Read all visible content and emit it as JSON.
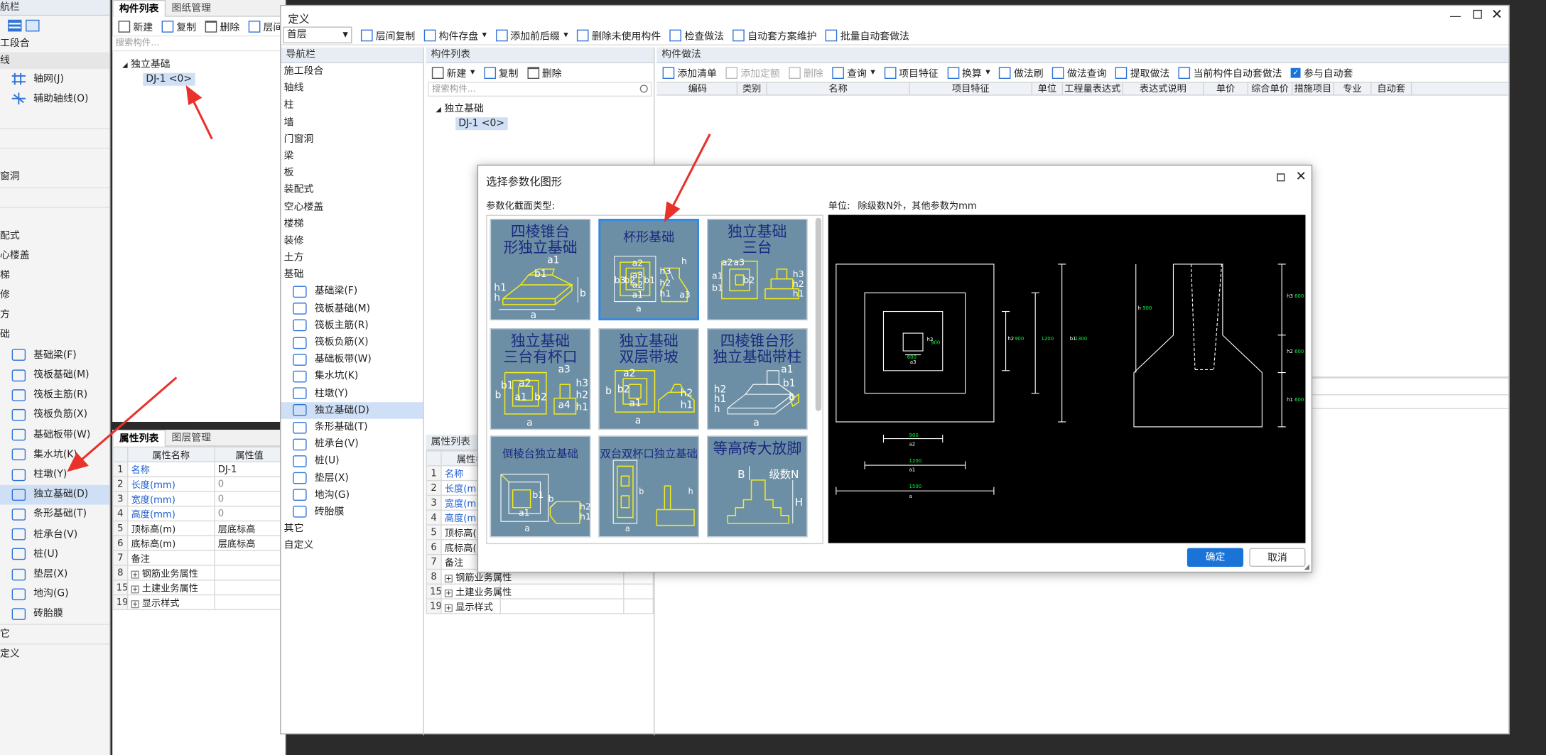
{
  "left_panel": {
    "title": "航栏",
    "items": [
      "工段合",
      "线"
    ],
    "axis_items": [
      "轴网(J)",
      "辅助轴线(O)"
    ],
    "mid_items": [
      "窗洞",
      "",
      "配式",
      "心楼盖",
      "梯",
      "修",
      "方",
      "础"
    ],
    "foundation_items": [
      "基础梁(F)",
      "筏板基础(M)",
      "筏板主筋(R)",
      "筏板负筋(X)",
      "基础板带(W)",
      "集水坑(K)",
      "柱墩(Y)",
      "独立基础(D)",
      "条形基础(T)",
      "桩承台(V)",
      "桩(U)",
      "垫层(X)",
      "地沟(G)",
      "砖胎膜"
    ],
    "tail_items": [
      "它",
      "定义"
    ]
  },
  "bg_component": {
    "tabs": [
      "构件列表",
      "图纸管理"
    ],
    "toolbar": [
      "新建",
      "复制",
      "删除",
      "层间"
    ],
    "search_placeholder": "搜索构件...",
    "tree_parent": "独立基础",
    "tree_child": "DJ-1 <0>"
  },
  "bg_props": {
    "tabs": [
      "属性列表",
      "图层管理"
    ],
    "header": [
      "属性名称",
      "属性值"
    ],
    "rows": [
      {
        "n": "1",
        "name": "名称",
        "val": "DJ-1",
        "blue": true
      },
      {
        "n": "2",
        "name": "长度(mm)",
        "val": "0",
        "blue": true
      },
      {
        "n": "3",
        "name": "宽度(mm)",
        "val": "0",
        "blue": true
      },
      {
        "n": "4",
        "name": "高度(mm)",
        "val": "0",
        "blue": true
      },
      {
        "n": "5",
        "name": "顶标高(m)",
        "val": "层底标高",
        "blue": false
      },
      {
        "n": "6",
        "name": "底标高(m)",
        "val": "层底标高",
        "blue": false
      },
      {
        "n": "7",
        "name": "备注",
        "val": "",
        "blue": false
      },
      {
        "n": "8",
        "name": "钢筋业务属性",
        "val": "",
        "blue": false,
        "expand": true
      },
      {
        "n": "15",
        "name": "土建业务属性",
        "val": "",
        "blue": false,
        "expand": true
      },
      {
        "n": "19",
        "name": "显示样式",
        "val": "",
        "blue": false,
        "expand": true
      }
    ]
  },
  "def_window": {
    "title": "定义",
    "floor_select": "首层",
    "toolbar": [
      "层间复制",
      "构件存盘",
      "添加前后缀",
      "删除未使用构件",
      "检查做法",
      "自动套方案维护",
      "批量自动套做法"
    ],
    "nav_title": "导航栏",
    "nav_items": [
      "施工段合",
      "轴线",
      "柱",
      "墙",
      "门窗洞",
      "梁",
      "板",
      "装配式",
      "空心楼盖",
      "楼梯",
      "装修",
      "土方",
      "基础"
    ],
    "nav_foundation": [
      "基础梁(F)",
      "筏板基础(M)",
      "筏板主筋(R)",
      "筏板负筋(X)",
      "基础板带(W)",
      "集水坑(K)",
      "柱墩(Y)",
      "独立基础(D)",
      "条形基础(T)",
      "桩承台(V)",
      "桩(U)",
      "垫层(X)",
      "地沟(G)",
      "砖胎膜"
    ],
    "nav_tail": [
      "其它",
      "自定义"
    ],
    "comp_title": "构件列表",
    "comp_toolbar": [
      "新建",
      "复制",
      "删除"
    ],
    "search_placeholder": "搜索构件...",
    "tree_parent": "独立基础",
    "tree_child": "DJ-1 <0>",
    "props_title": "属性列表",
    "props_header": "属性名",
    "props_rows": [
      {
        "n": "1",
        "name": "名称",
        "blue": true
      },
      {
        "n": "2",
        "name": "长度(mm",
        "blue": true
      },
      {
        "n": "3",
        "name": "宽度(mm",
        "blue": true
      },
      {
        "n": "4",
        "name": "高度(mm",
        "blue": true
      },
      {
        "n": "5",
        "name": "顶标高(",
        "blue": false
      },
      {
        "n": "6",
        "name": "底标高(",
        "blue": false
      },
      {
        "n": "7",
        "name": "备注",
        "blue": false
      },
      {
        "n": "8",
        "name": "钢筋业务属性",
        "blue": false,
        "expand": true
      },
      {
        "n": "15",
        "name": "土建业务属性",
        "blue": false,
        "expand": true
      },
      {
        "n": "19",
        "name": "显示样式",
        "blue": false,
        "expand": true
      }
    ],
    "method_title": "构件做法",
    "method_toolbar": [
      "添加清单",
      "添加定额",
      "删除",
      "查询",
      "项目特征",
      "换算",
      "做法刷",
      "做法查询",
      "提取做法",
      "当前构件自动套做法",
      "参与自动套"
    ],
    "method_columns": [
      "编码",
      "类别",
      "名称",
      "项目特征",
      "单位",
      "工程量表达式",
      "表达式说明",
      "单价",
      "综合单价",
      "措施项目",
      "专业",
      "自动套"
    ]
  },
  "dialog": {
    "title": "选择参数化图形",
    "section_label": "参数化截面类型:",
    "unit_label": "单位:",
    "unit_text": "除级数N外，其他参数为mm",
    "cards": [
      {
        "title": "四棱锥台形独立基础",
        "selected": false
      },
      {
        "title": "杯形基础",
        "selected": true
      },
      {
        "title": "独立基础三台",
        "selected": false
      },
      {
        "title": "独立基础三台有杯口",
        "selected": false
      },
      {
        "title": "独立基础双层带坡",
        "selected": false
      },
      {
        "title": "四棱锥台形独立基础带柱",
        "selected": false
      },
      {
        "title": "倒棱台独立基础",
        "selected": false
      },
      {
        "title": "双台双杯口独立基础",
        "selected": false
      },
      {
        "title": "等高砖大放脚",
        "selected": false
      }
    ],
    "card_lines": [
      [
        "四棱锥台",
        "形独立基础"
      ],
      [
        "杯形基础"
      ],
      [
        "独立基础",
        "三台"
      ],
      [
        "独立基础",
        "三台有杯口"
      ],
      [
        "独立基础",
        "双层带坡"
      ],
      [
        "四棱锥台形",
        "独立基础带柱"
      ],
      [
        "倒棱台独立基础"
      ],
      [
        "双台双杯口独立基础"
      ],
      [
        "等高砖大放脚"
      ]
    ],
    "card_labels": {
      "c0": [
        "a1",
        "b1",
        "h1",
        "h",
        "a",
        "b"
      ],
      "c1": [
        "a2",
        "b3",
        "b2",
        "b1",
        "a3",
        "a2",
        "a1",
        "h3",
        "h2",
        "h1",
        "a3",
        "h",
        "a"
      ],
      "c2": [
        "a3",
        "a2",
        "a1",
        "b2",
        "b1",
        "h3",
        "h2",
        "h1"
      ],
      "c3": [
        "a3",
        "b1",
        "a2",
        "b",
        "a1",
        "b2",
        "a4",
        "h3",
        "h2",
        "h1",
        "a"
      ],
      "c4": [
        "a2",
        "b2",
        "a1",
        "b",
        "h2",
        "h1",
        "a"
      ],
      "c5": [
        "a1",
        "h2",
        "h1",
        "h",
        "b1",
        "b",
        "a"
      ],
      "c6": [
        "b1",
        "b",
        "a1",
        "h2",
        "h1",
        "a"
      ],
      "c7": [
        "b",
        "h",
        "a"
      ],
      "c8": [
        "B",
        "级数N",
        "H"
      ]
    },
    "preview_labels": {
      "plan": [
        "a3",
        "600",
        "h3",
        "900",
        "h2",
        "900",
        "1200",
        "b1",
        "1300",
        "900",
        "a2",
        "1200",
        "a1",
        "1500",
        "a"
      ],
      "section": [
        "h 900",
        "h3 600",
        "h2 600",
        "h1 600"
      ]
    },
    "ok_button": "确定",
    "cancel_button": "取消"
  },
  "colors": {
    "accent": "#1a73d6",
    "card_bg": "#6d8fa5",
    "selection": "#cfe0f6",
    "drawing_bg": "#000000",
    "dim_green": "#00ff3c",
    "yellow_line": "#f2ea1c"
  }
}
